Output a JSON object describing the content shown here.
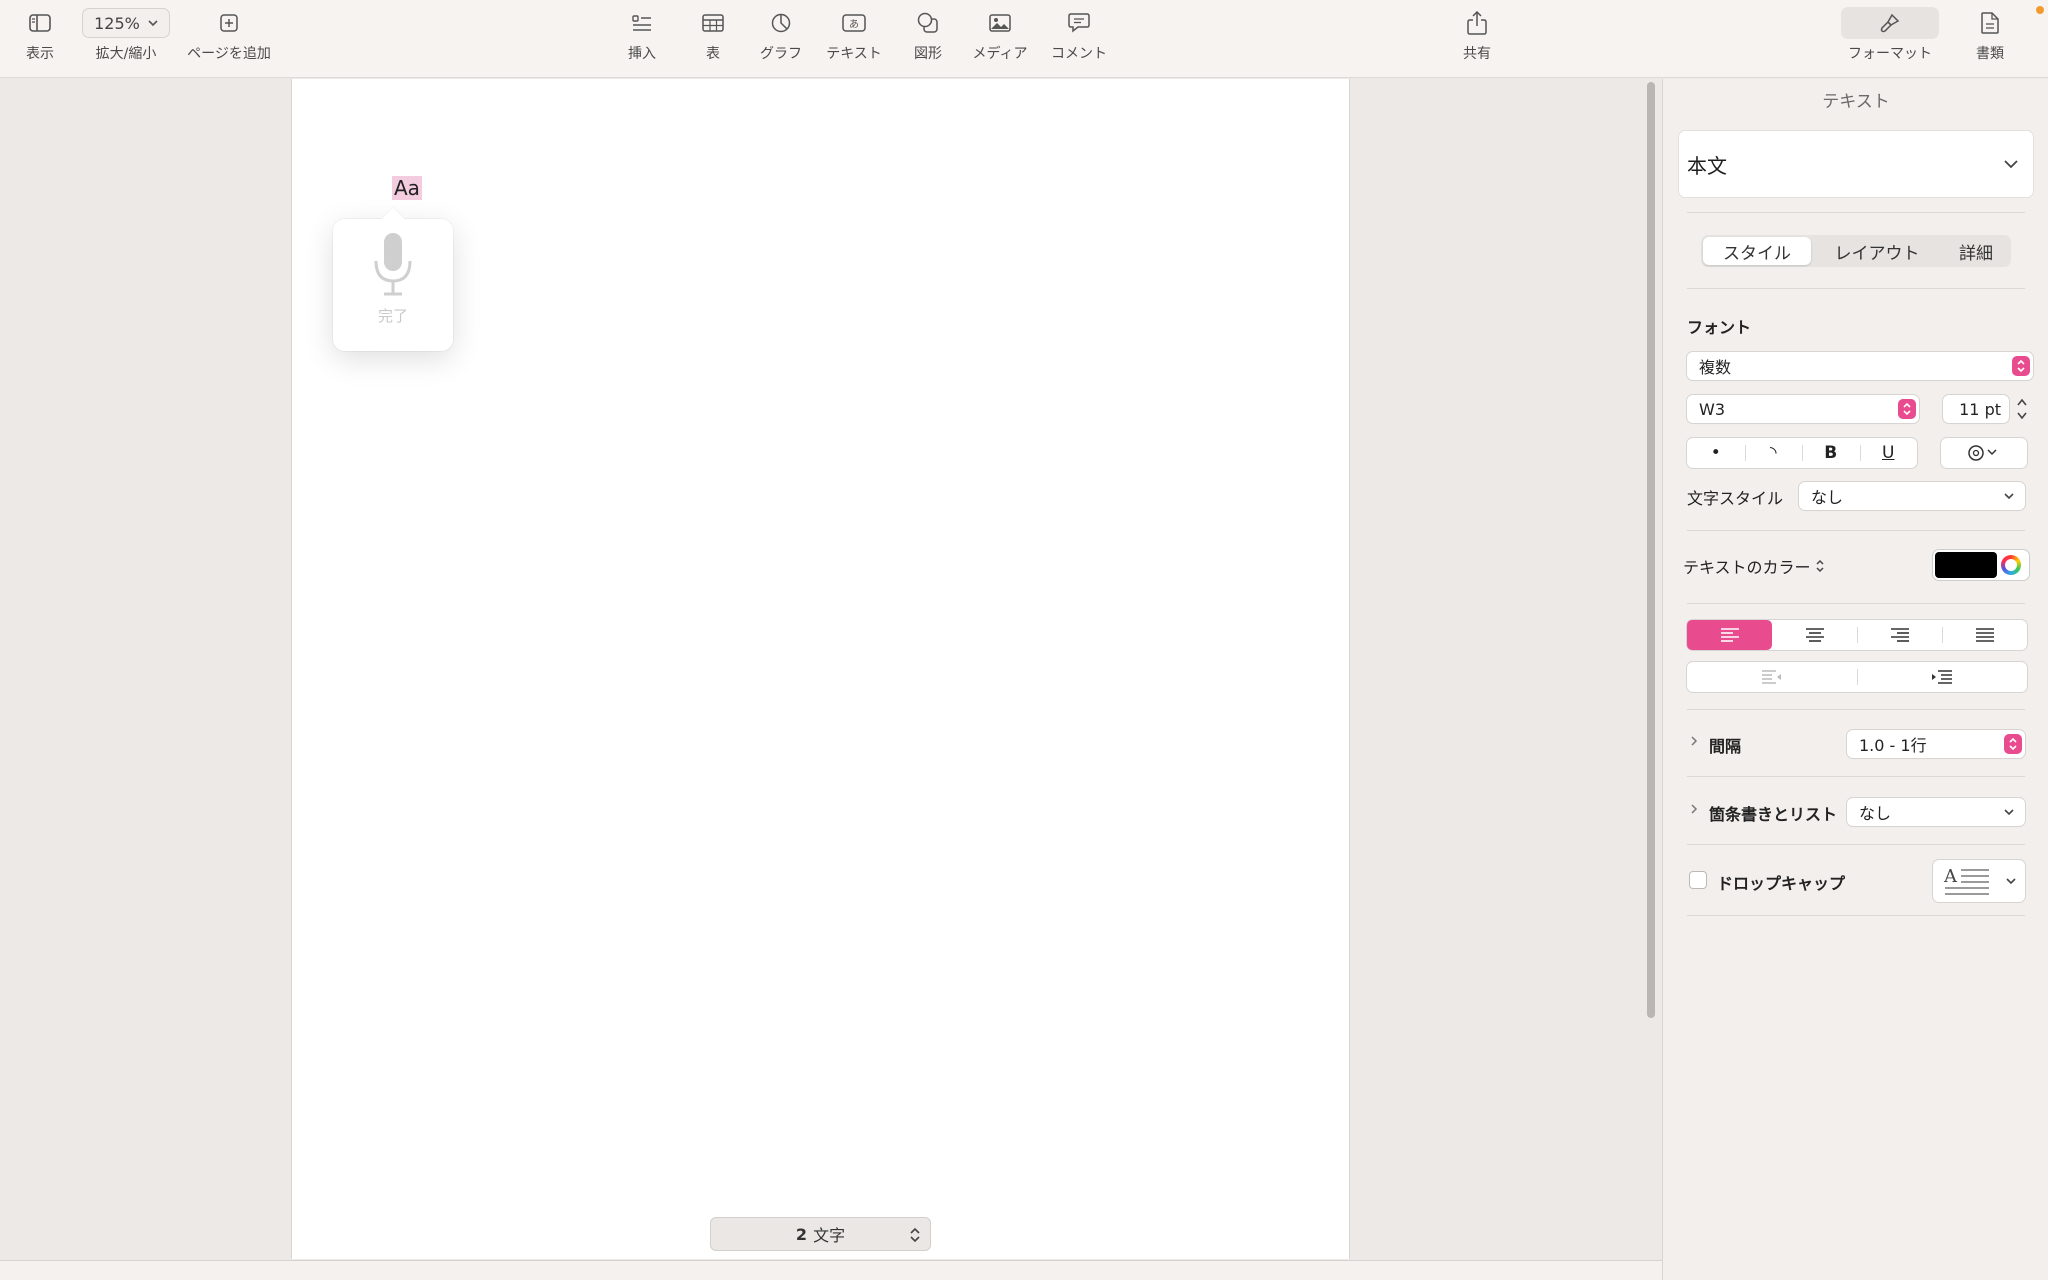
{
  "toolbar": {
    "view_label": "表示",
    "zoom_value": "125%",
    "zoom_label": "拡大/縮小",
    "add_page_label": "ページを追加",
    "insert_label": "挿入",
    "table_label": "表",
    "chart_label": "グラフ",
    "text_label": "テキスト",
    "shape_label": "図形",
    "media_label": "メディア",
    "comment_label": "コメント",
    "share_label": "共有",
    "format_label": "フォーマット",
    "document_label": "書類"
  },
  "document": {
    "selected_text": "Aa",
    "dictation_done": "完了",
    "word_count_number": "2",
    "word_count_unit": "文字"
  },
  "inspector": {
    "title": "テキスト",
    "paragraph_style": "本文",
    "tabs": [
      "スタイル",
      "レイアウト",
      "詳細"
    ],
    "active_tab": "スタイル",
    "font_heading": "フォント",
    "font_family": "複数",
    "font_weight": "W3",
    "font_size": "11 pt",
    "style_buttons": [
      "•",
      "◝",
      "B",
      "U"
    ],
    "char_style_label": "文字スタイル",
    "char_style_value": "なし",
    "text_color_label": "テキストのカラー",
    "text_color": "#000000",
    "alignment": [
      "left",
      "center",
      "right",
      "justify"
    ],
    "alignment_active": "left",
    "spacing_label": "間隔",
    "spacing_value": "1.0 - 1行",
    "bullets_label": "箇条書きとリスト",
    "bullets_value": "なし",
    "dropcap_label": "ドロップキャップ"
  },
  "colors": {
    "accent": "#e94b8f",
    "selection_highlight": "#f4cce0",
    "notification_dot": "#f29a2e"
  }
}
